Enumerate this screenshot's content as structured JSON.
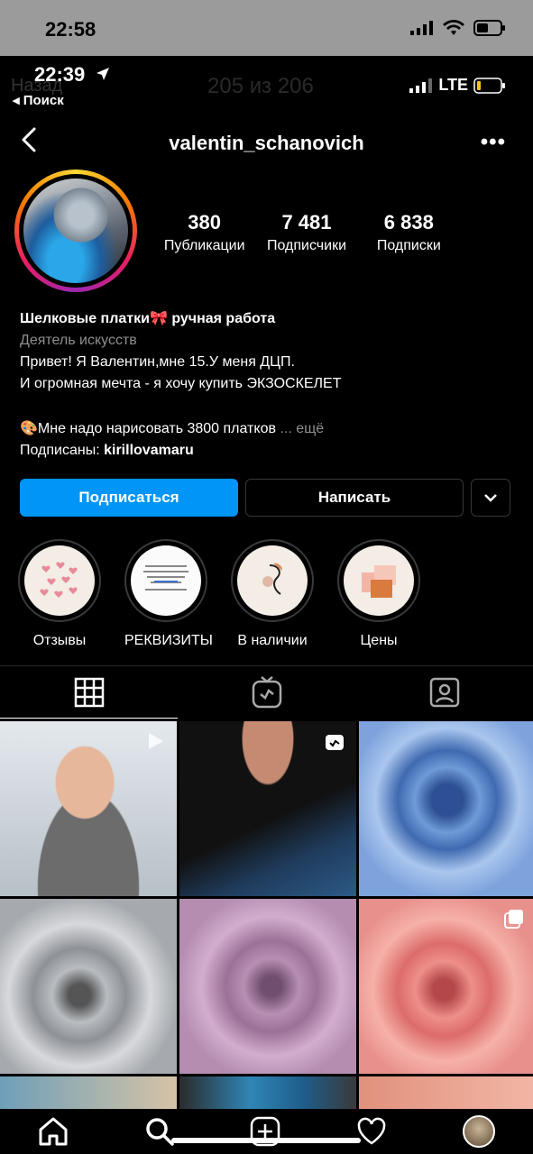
{
  "outer_status": {
    "time": "22:58"
  },
  "inner_status": {
    "time": "22:39",
    "back_search": "◂ Поиск",
    "ghost_back": "Назад",
    "ghost_counter": "205 из 206",
    "network": "LTE"
  },
  "nav": {
    "username": "valentin_schanovich"
  },
  "stats": [
    {
      "value": "380",
      "label": "Публикации"
    },
    {
      "value": "7 481",
      "label": "Подписчики"
    },
    {
      "value": "6 838",
      "label": "Подписки"
    }
  ],
  "bio": {
    "name": "Шелковые платки🎀 ручная работа",
    "category": "Деятель искусств",
    "line1": "Привет! Я Валентин,мне 15.У меня ДЦП.",
    "line2": "И огромная мечта - я хочу купить ЭКЗОСКЕЛЕТ",
    "line3": "🎨Мне надо нарисовать 3800 платков",
    "more": "... ещё",
    "followed_prefix": "Подписаны: ",
    "followed_by": "kirillovamaru"
  },
  "buttons": {
    "follow": "Подписаться",
    "message": "Написать"
  },
  "highlights": [
    {
      "label": "Отзывы"
    },
    {
      "label": "РЕКВИЗИТЫ"
    },
    {
      "label": "В наличии"
    },
    {
      "label": "Цены"
    }
  ],
  "colors": {
    "accent": "#0095f6",
    "background": "#000000"
  }
}
